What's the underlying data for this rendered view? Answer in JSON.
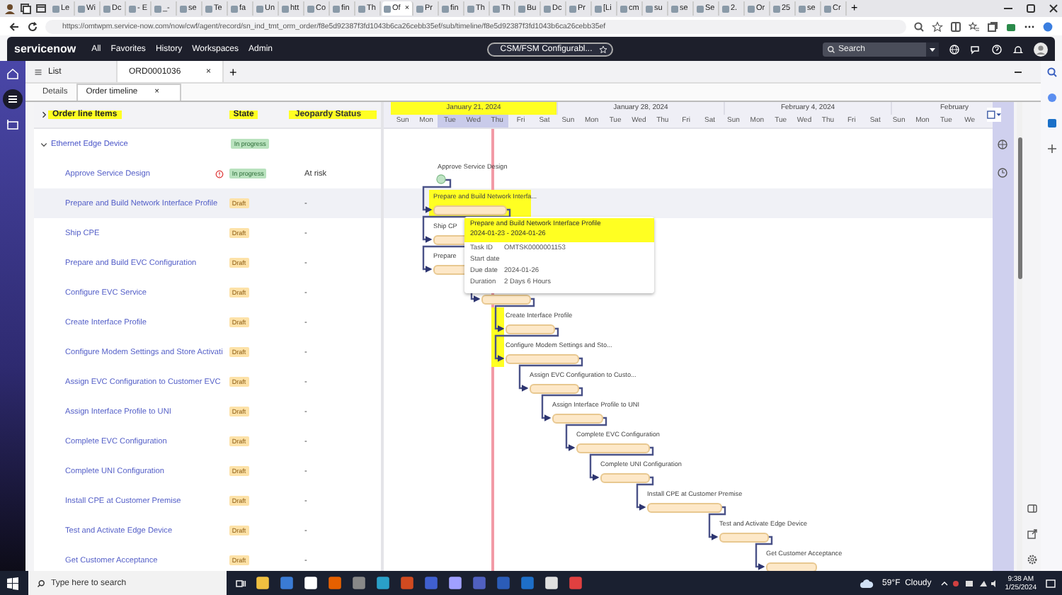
{
  "browser": {
    "tabs": [
      {
        "label": "Le",
        "selected": false
      },
      {
        "label": "Wi",
        "selected": false
      },
      {
        "label": "Dc",
        "selected": false
      },
      {
        "label": "- E",
        "selected": false
      },
      {
        "label": "_-",
        "selected": false
      },
      {
        "label": "se",
        "selected": false
      },
      {
        "label": "Te",
        "selected": false
      },
      {
        "label": "fa",
        "selected": false
      },
      {
        "label": "Un",
        "selected": false
      },
      {
        "label": "htt",
        "selected": false
      },
      {
        "label": "Co",
        "selected": false
      },
      {
        "label": "fin",
        "selected": false
      },
      {
        "label": "Th",
        "selected": false
      },
      {
        "label": "Of",
        "selected": true
      },
      {
        "label": "Pr",
        "selected": false
      },
      {
        "label": "fin",
        "selected": false
      },
      {
        "label": "Th",
        "selected": false
      },
      {
        "label": "Th",
        "selected": false
      },
      {
        "label": "Bu",
        "selected": false
      },
      {
        "label": "Dc",
        "selected": false
      },
      {
        "label": "Pr",
        "selected": false
      },
      {
        "label": "[Li",
        "selected": false
      },
      {
        "label": "cm",
        "selected": false
      },
      {
        "label": "su",
        "selected": false
      },
      {
        "label": "se",
        "selected": false
      },
      {
        "label": "Se",
        "selected": false
      },
      {
        "label": "2.",
        "selected": false
      },
      {
        "label": "Or",
        "selected": false
      },
      {
        "label": "25",
        "selected": false
      },
      {
        "label": "se",
        "selected": false
      },
      {
        "label": "Cr",
        "selected": false
      }
    ],
    "new_tab": "+",
    "close": "×",
    "url": "https://omtwpm.service-now.com/now/cwf/agent/record/sn_ind_tmt_orm_order/f8e5d92387f3fd1043b6ca26cebb35ef/sub/timeline/f8e5d92387f3fd1043b6ca26cebb35ef"
  },
  "header": {
    "logo": "servicenow",
    "nav": [
      "All",
      "Favorites",
      "History",
      "Workspaces",
      "Admin"
    ],
    "scope": "CSM/FSM Configurabl...",
    "search_placeholder": "Search"
  },
  "workspace_tabs": [
    {
      "label": "List",
      "kind": "list",
      "selected": false
    },
    {
      "label": "ORD0001036",
      "kind": "record",
      "selected": true
    }
  ],
  "add_tab": "+",
  "subtabs": [
    {
      "label": "Details",
      "selected": false,
      "closable": false
    },
    {
      "label": "Order timeline",
      "selected": true,
      "closable": true
    }
  ],
  "table": {
    "columns": [
      {
        "label": "Order line Items",
        "highlighted": true
      },
      {
        "label": "State",
        "highlighted": true
      },
      {
        "label": "Jeopardy Status",
        "highlighted": true
      }
    ],
    "group": {
      "label": "Ethernet Edge Device",
      "expanded": true,
      "state": {
        "label": "In progress",
        "kind": "progress"
      }
    },
    "rows": [
      {
        "name": "Approve Service Design",
        "warning": true,
        "state": {
          "label": "In progress",
          "kind": "progress"
        },
        "jeopardy": "At risk",
        "selected": false,
        "bar": {
          "kind": "milestone"
        },
        "gantt_label": "Approve Service Design"
      },
      {
        "name": "Prepare and Build Network Interface Profile",
        "warning": false,
        "state": {
          "label": "Draft",
          "kind": "draft"
        },
        "jeopardy": "-",
        "selected": true,
        "bar": {
          "kind": "task"
        },
        "gantt_label": "Prepare and Build Network Interfa...",
        "highlight": {
          "kind": "bar"
        }
      },
      {
        "name": "Ship CPE",
        "warning": false,
        "state": {
          "label": "Draft",
          "kind": "draft"
        },
        "jeopardy": "-",
        "selected": false,
        "bar": {
          "kind": "task"
        },
        "gantt_label": "Ship CP"
      },
      {
        "name": "Prepare and Build EVC Configuration",
        "warning": false,
        "state": {
          "label": "Draft",
          "kind": "draft"
        },
        "jeopardy": "-",
        "selected": false,
        "bar": {
          "kind": "task"
        },
        "gantt_label": "Prepare"
      },
      {
        "name": "Configure EVC Service",
        "warning": false,
        "state": {
          "label": "Draft",
          "kind": "draft"
        },
        "jeopardy": "-",
        "selected": false,
        "bar": {
          "kind": "task"
        }
      },
      {
        "name": "Create Interface Profile",
        "warning": false,
        "state": {
          "label": "Draft",
          "kind": "draft"
        },
        "jeopardy": "-",
        "selected": false,
        "bar": {
          "kind": "task"
        },
        "gantt_label": "Create Interface Profile",
        "highlight": {
          "kind": "arrow"
        }
      },
      {
        "name": "Configure Modem Settings and Store Activati",
        "warning": false,
        "state": {
          "label": "Draft",
          "kind": "draft"
        },
        "jeopardy": "-",
        "selected": false,
        "bar": {
          "kind": "task"
        },
        "gantt_label": "Configure Modem Settings and Sto...",
        "highlight": {
          "kind": "arrow"
        }
      },
      {
        "name": "Assign EVC Configuration to Customer EVC",
        "warning": false,
        "state": {
          "label": "Draft",
          "kind": "draft"
        },
        "jeopardy": "-",
        "selected": false,
        "bar": {
          "kind": "task"
        },
        "gantt_label": "Assign EVC Configuration to Custo..."
      },
      {
        "name": "Assign Interface Profile to UNI",
        "warning": false,
        "state": {
          "label": "Draft",
          "kind": "draft"
        },
        "jeopardy": "-",
        "selected": false,
        "bar": {
          "kind": "task"
        },
        "gantt_label": "Assign Interface Profile to UNI"
      },
      {
        "name": "Complete EVC Configuration",
        "warning": false,
        "state": {
          "label": "Draft",
          "kind": "draft"
        },
        "jeopardy": "-",
        "selected": false,
        "bar": {
          "kind": "task"
        },
        "gantt_label": "Complete EVC Configuration"
      },
      {
        "name": "Complete UNI Configuration",
        "warning": false,
        "state": {
          "label": "Draft",
          "kind": "draft"
        },
        "jeopardy": "-",
        "selected": false,
        "bar": {
          "kind": "task"
        },
        "gantt_label": "Complete UNI Configuration"
      },
      {
        "name": "Install CPE at Customer Premise",
        "warning": false,
        "state": {
          "label": "Draft",
          "kind": "draft"
        },
        "jeopardy": "-",
        "selected": false,
        "bar": {
          "kind": "task"
        },
        "gantt_label": "Install CPE at Customer Premise"
      },
      {
        "name": "Test and Activate Edge Device",
        "warning": false,
        "state": {
          "label": "Draft",
          "kind": "draft"
        },
        "jeopardy": "-",
        "selected": false,
        "bar": {
          "kind": "task"
        },
        "gantt_label": "Test and Activate Edge Device"
      },
      {
        "name": "Get Customer Acceptance",
        "warning": false,
        "state": {
          "label": "Draft",
          "kind": "draft"
        },
        "jeopardy": "-",
        "selected": false,
        "bar": {
          "kind": "task"
        },
        "gantt_label": "Get Customer Acceptance"
      }
    ]
  },
  "timeline": {
    "weeks": [
      {
        "label": "January 21, 2024",
        "highlighted": true
      },
      {
        "label": "January 28, 2024",
        "highlighted": false
      },
      {
        "label": "February 4, 2024",
        "highlighted": false
      },
      {
        "label": "February",
        "highlighted": false
      }
    ],
    "days": [
      {
        "label": "Sun",
        "shaded": false
      },
      {
        "label": "Mon",
        "shaded": false
      },
      {
        "label": "Tue",
        "shaded": true
      },
      {
        "label": "Wed",
        "shaded": true
      },
      {
        "label": "Thu",
        "shaded": true
      },
      {
        "label": "Fri",
        "shaded": false
      },
      {
        "label": "Sat",
        "shaded": false
      },
      {
        "label": "Sun",
        "shaded": false
      },
      {
        "label": "Mon",
        "shaded": false
      },
      {
        "label": "Tue",
        "shaded": false
      },
      {
        "label": "Wed",
        "shaded": false
      },
      {
        "label": "Thu",
        "shaded": false
      },
      {
        "label": "Fri",
        "shaded": false
      },
      {
        "label": "Sat",
        "shaded": false
      },
      {
        "label": "Sun",
        "shaded": false
      },
      {
        "label": "Mon",
        "shaded": false
      },
      {
        "label": "Tue",
        "shaded": false
      },
      {
        "label": "Wed",
        "shaded": false
      },
      {
        "label": "Thu",
        "shaded": false
      },
      {
        "label": "Fri",
        "shaded": false
      },
      {
        "label": "Sat",
        "shaded": false
      },
      {
        "label": "Sun",
        "shaded": false
      },
      {
        "label": "Mon",
        "shaded": false
      },
      {
        "label": "Tue",
        "shaded": false
      },
      {
        "label": "We",
        "shaded": false
      }
    ],
    "tooltip": {
      "title": "Prepare and Build Network Interface Profile",
      "dates": "2024-01-23 - 2024-01-26",
      "highlighted": true,
      "fields": [
        {
          "label": "Task ID",
          "value": "OMTSK0000001153"
        },
        {
          "label": "Start date"
        },
        {
          "label": "Due date",
          "value": "2024-01-26"
        },
        {
          "label": "Duration",
          "value": "2 Days 6 Hours"
        }
      ]
    }
  },
  "taskbar": {
    "search_placeholder": "Type here to search",
    "weather": "59°F  Cloudy",
    "time": "9:38 AM",
    "date": "1/25/2024"
  }
}
